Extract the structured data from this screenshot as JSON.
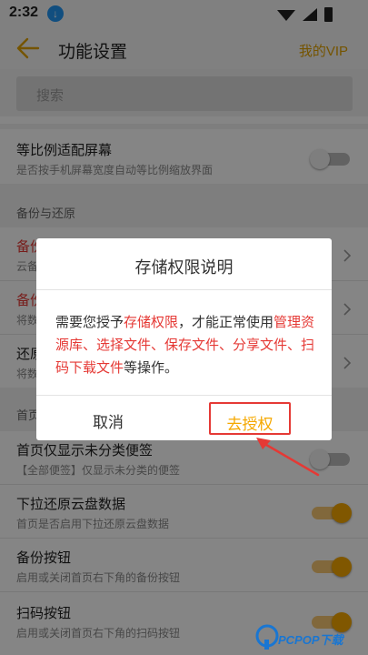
{
  "status_bar": {
    "time": "2:32",
    "download_icon": "download-icon",
    "icons": [
      "wifi-icon",
      "signal-icon",
      "battery-icon"
    ]
  },
  "header": {
    "title": "功能设置",
    "vip_label": "我的VIP",
    "back_icon": "back-arrow-icon"
  },
  "search": {
    "placeholder": "搜索"
  },
  "settings": {
    "row_aspect": {
      "title": "等比例适配屏幕",
      "subtitle": "是否按手机屏幕宽度自动等比例缩放界面",
      "enabled": false
    },
    "section_backup": "备份与还原",
    "row_backup1": {
      "title": "备份",
      "subtitle": "云备"
    },
    "row_backup2": {
      "title": "备份",
      "subtitle": "将数"
    },
    "row_restore": {
      "title": "还原",
      "subtitle": "将数"
    },
    "section_home": "首页",
    "row_uncat": {
      "title": "首页仅显示未分类便签",
      "subtitle": "【全部便签】仅显示未分类的便签",
      "enabled": false
    },
    "row_pull": {
      "title": "下拉还原云盘数据",
      "subtitle": "首页是否启用下拉还原云盘数据",
      "enabled": true
    },
    "row_backup_btn": {
      "title": "备份按钮",
      "subtitle": "启用或关闭首页右下角的备份按钮",
      "enabled": true
    },
    "row_scan_btn": {
      "title": "扫码按钮",
      "subtitle": "启用或关闭首页右下角的扫码按钮",
      "enabled": true
    }
  },
  "dialog": {
    "title": "存储权限说明",
    "body_prefix": "需要您授予",
    "body_highlight1": "存储权限",
    "body_mid": "，才能正常使用",
    "body_highlight2": "管理资源库、选择文件、保存文件、分享文件、扫码下载文件",
    "body_suffix": "等操作。",
    "cancel_label": "取消",
    "grant_label": "去授权"
  },
  "watermark": {
    "text": "PCPOP下载"
  },
  "colors": {
    "accent": "#f5a800",
    "highlight": "#e53935",
    "vip": "#e0a100"
  }
}
